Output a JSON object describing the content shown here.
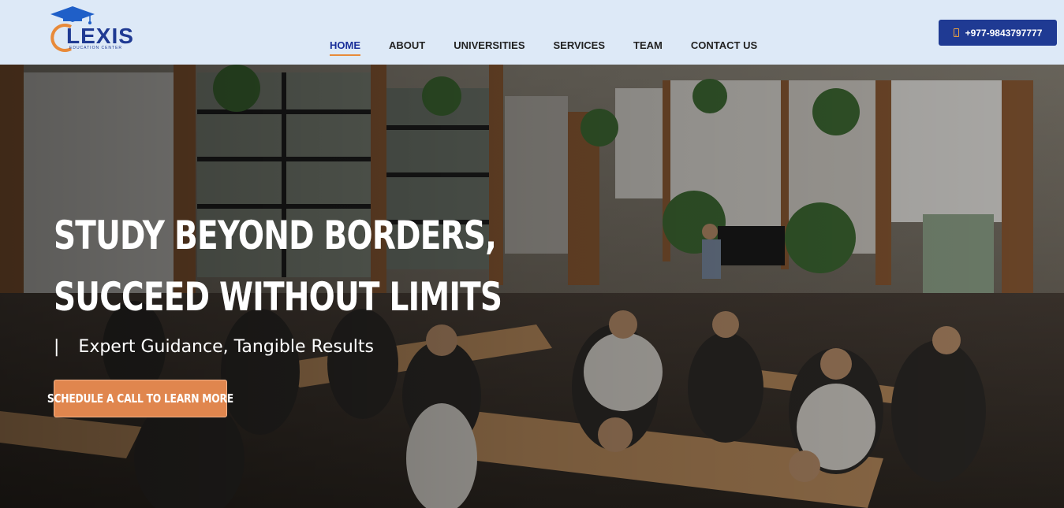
{
  "brand": {
    "name": "LEXIS",
    "tagline": "EDUCATION CENTER",
    "primary_color": "#1f3a93",
    "accent_color": "#e88a3a",
    "logo_icon": "graduation-cap-icon"
  },
  "nav": {
    "items": [
      {
        "label": "HOME",
        "active": true
      },
      {
        "label": "ABOUT",
        "active": false
      },
      {
        "label": "UNIVERSITIES",
        "active": false
      },
      {
        "label": "SERVICES",
        "active": false
      },
      {
        "label": "TEAM",
        "active": false
      },
      {
        "label": "CONTACT US",
        "active": false
      }
    ]
  },
  "contact": {
    "phone": "+977-9843797777",
    "icon": "phone-icon"
  },
  "hero": {
    "title_line1": "Study Beyond Borders,",
    "title_line2": "Succeed Without Limits",
    "subtitle_bar": "|",
    "subtitle": "Expert Guidance, Tangible Results",
    "cta_label": "SCHEDULE A CALL TO LEARN MORE",
    "cta_color": "#e0864e",
    "background": "classroom-photo"
  }
}
